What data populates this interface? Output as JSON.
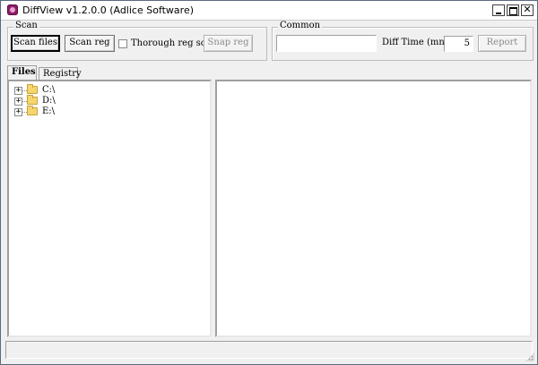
{
  "window": {
    "title": "DiffView v1.2.0.0 (Adlice Software)"
  },
  "scan": {
    "group_label": "Scan",
    "scan_files_label": "Scan files",
    "scan_reg_label": "Scan reg",
    "thorough_reg_scan_label": "Thorough reg scan",
    "thorough_reg_scan_checked": false,
    "snap_reg_label": "Snap reg"
  },
  "common": {
    "group_label": "Common",
    "path_value": "",
    "diff_time_label": "Diff Time (mn)",
    "diff_time_value": "5",
    "report_label": "Report"
  },
  "tabs": [
    {
      "label": "Files",
      "active": true
    },
    {
      "label": "Registry",
      "active": false
    }
  ],
  "tree": {
    "items": [
      {
        "label": "C:\\",
        "expander": "+"
      },
      {
        "label": "D:\\",
        "expander": "+"
      },
      {
        "label": "E:\\",
        "expander": "+"
      }
    ]
  },
  "status": {
    "text": ""
  }
}
